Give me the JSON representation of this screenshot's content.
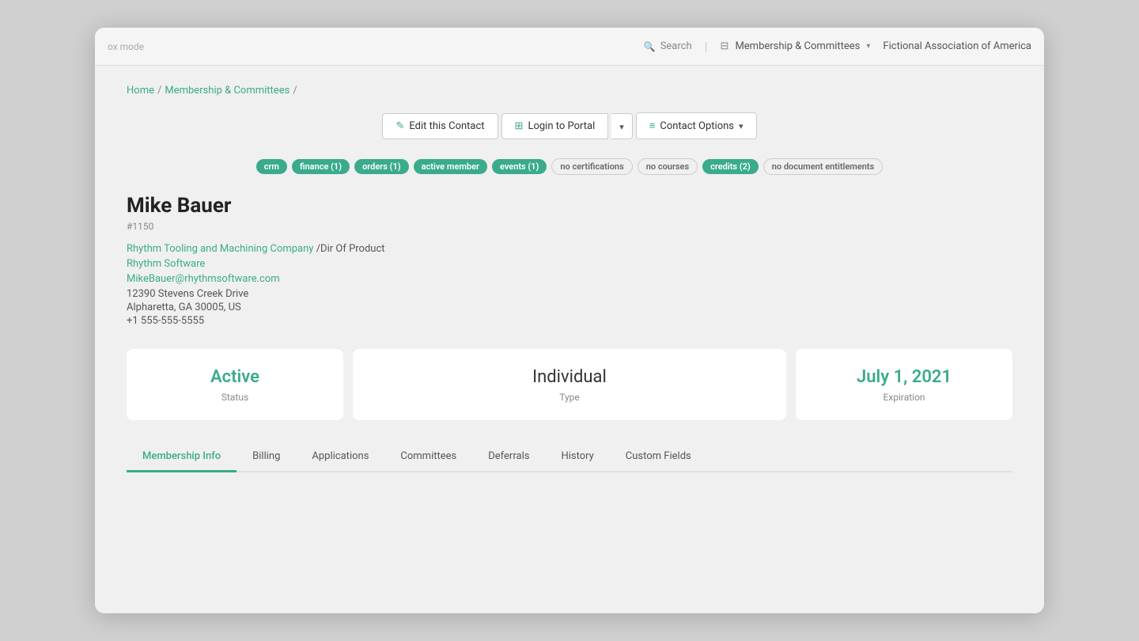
{
  "browser": {
    "mode_label": "ox mode",
    "search_placeholder": "Search",
    "nav_label": "Membership & Committees",
    "org_label": "Fictional Association of America"
  },
  "breadcrumb": {
    "home": "Home",
    "section": "Membership & Committees",
    "sep": "/"
  },
  "actions": {
    "edit_label": "Edit this Contact",
    "login_label": "Login to Portal",
    "options_label": "Contact Options",
    "edit_icon": "✎",
    "login_icon": "⊞",
    "options_icon": "≡"
  },
  "tags": [
    {
      "label": "crm",
      "style": "green"
    },
    {
      "label": "finance (1)",
      "style": "green"
    },
    {
      "label": "orders (1)",
      "style": "green"
    },
    {
      "label": "active member",
      "style": "active-member"
    },
    {
      "label": "events (1)",
      "style": "green"
    },
    {
      "label": "no certifications",
      "style": "gray"
    },
    {
      "label": "no courses",
      "style": "gray"
    },
    {
      "label": "credits (2)",
      "style": "green"
    },
    {
      "label": "no document entitlements",
      "style": "gray"
    }
  ],
  "contact": {
    "name": "Mike Bauer",
    "id": "#1150",
    "company": "Rhythm Tooling and Machining Company",
    "company_suffix": " /Dir Of Product",
    "software": "Rhythm Software",
    "email": "MikeBauer@rhythmsoftware.com",
    "address1": "12390 Stevens Creek Drive",
    "address2": "Alpharetta, GA 30005, US",
    "phone": "+1 555-555-5555"
  },
  "status_cards": {
    "status": {
      "value": "Active",
      "label": "Status"
    },
    "type": {
      "value": "Individual",
      "label": "Type"
    },
    "expiration": {
      "value": "July 1, 2021",
      "label": "Expiration"
    }
  },
  "tabs": [
    {
      "label": "Membership Info",
      "active": true
    },
    {
      "label": "Billing",
      "active": false
    },
    {
      "label": "Applications",
      "active": false
    },
    {
      "label": "Committees",
      "active": false
    },
    {
      "label": "Deferrals",
      "active": false
    },
    {
      "label": "History",
      "active": false
    },
    {
      "label": "Custom Fields",
      "active": false
    }
  ],
  "colors": {
    "accent": "#3aab8c",
    "text_muted": "#888",
    "text_dark": "#222"
  }
}
